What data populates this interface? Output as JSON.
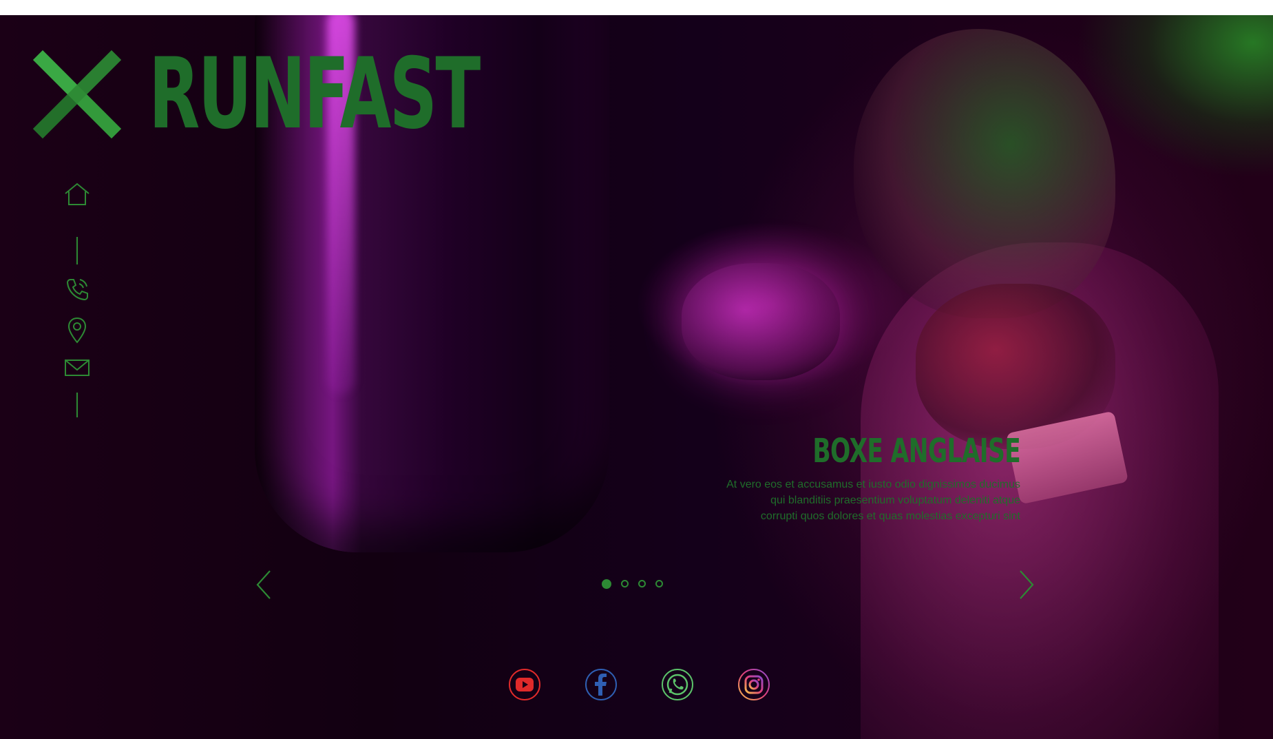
{
  "brand": {
    "name": "RUNFAST",
    "logo_icon": "x-logo-icon",
    "accent_color": "#1f6d2a"
  },
  "sidenav": {
    "items": [
      {
        "icon": "home-icon"
      },
      {
        "icon": "phone-icon"
      },
      {
        "icon": "location-pin-icon"
      },
      {
        "icon": "mail-icon"
      }
    ]
  },
  "slider": {
    "title": "BOXE ANGLAISE",
    "text_lines": [
      "At vero eos et accusamus et iusto odio dignissimos ducimus",
      "qui blanditiis praesentium voluptatum deleniti atque",
      "corrupti quos dolores et quas molestias excepturi sint"
    ],
    "prev_icon": "chevron-left-icon",
    "next_icon": "chevron-right-icon",
    "dots_count": 4,
    "active_dot": 1
  },
  "social": [
    {
      "icon": "youtube-icon",
      "color": "#e02a2a"
    },
    {
      "icon": "facebook-icon",
      "color": "#2f5fb3"
    },
    {
      "icon": "whatsapp-icon",
      "color": "#5cc36a"
    },
    {
      "icon": "instagram-icon",
      "color": "#e0407a"
    }
  ]
}
